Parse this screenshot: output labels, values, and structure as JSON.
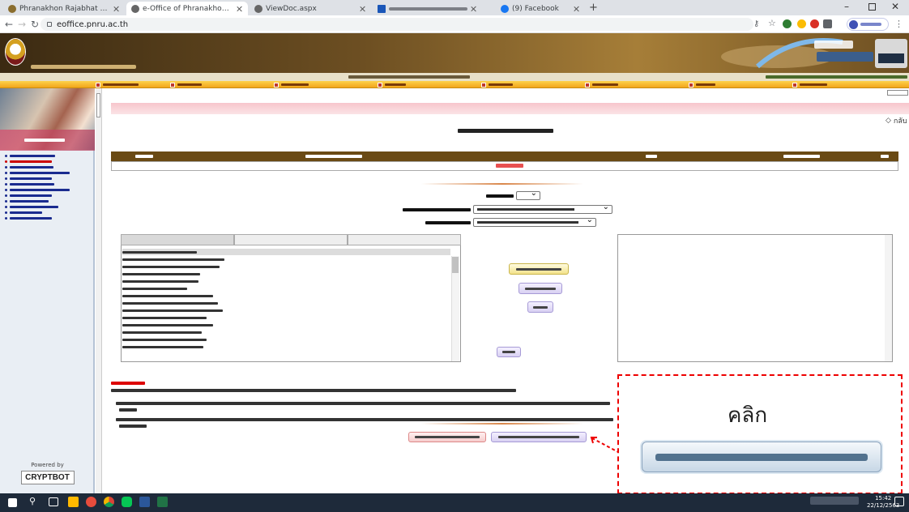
{
  "browser": {
    "tabs": [
      {
        "title": "Phranakhon Rajabhat University",
        "active": false
      },
      {
        "title": "e-Office of Phranakhon Rajabhat",
        "active": true
      },
      {
        "title": "ViewDoc.aspx",
        "active": false
      },
      {
        "title": "",
        "active": false
      },
      {
        "title": "(9) Facebook",
        "active": false
      }
    ],
    "url": "eoffice.pnru.ac.th"
  },
  "sidebar": {
    "powered_by": "Powered by",
    "brand": "CRYPTBOT"
  },
  "main": {
    "back_label": "กลับ"
  },
  "annotation": {
    "click_label": "คลิก"
  },
  "taskbar": {
    "time": "15:42",
    "date": "22/12/2563"
  },
  "colors": {
    "menubar": "#f2a51a",
    "header_row": "#6a4a14",
    "highlight_red": "#e00000",
    "pink_bar": "#f7c6cc"
  }
}
